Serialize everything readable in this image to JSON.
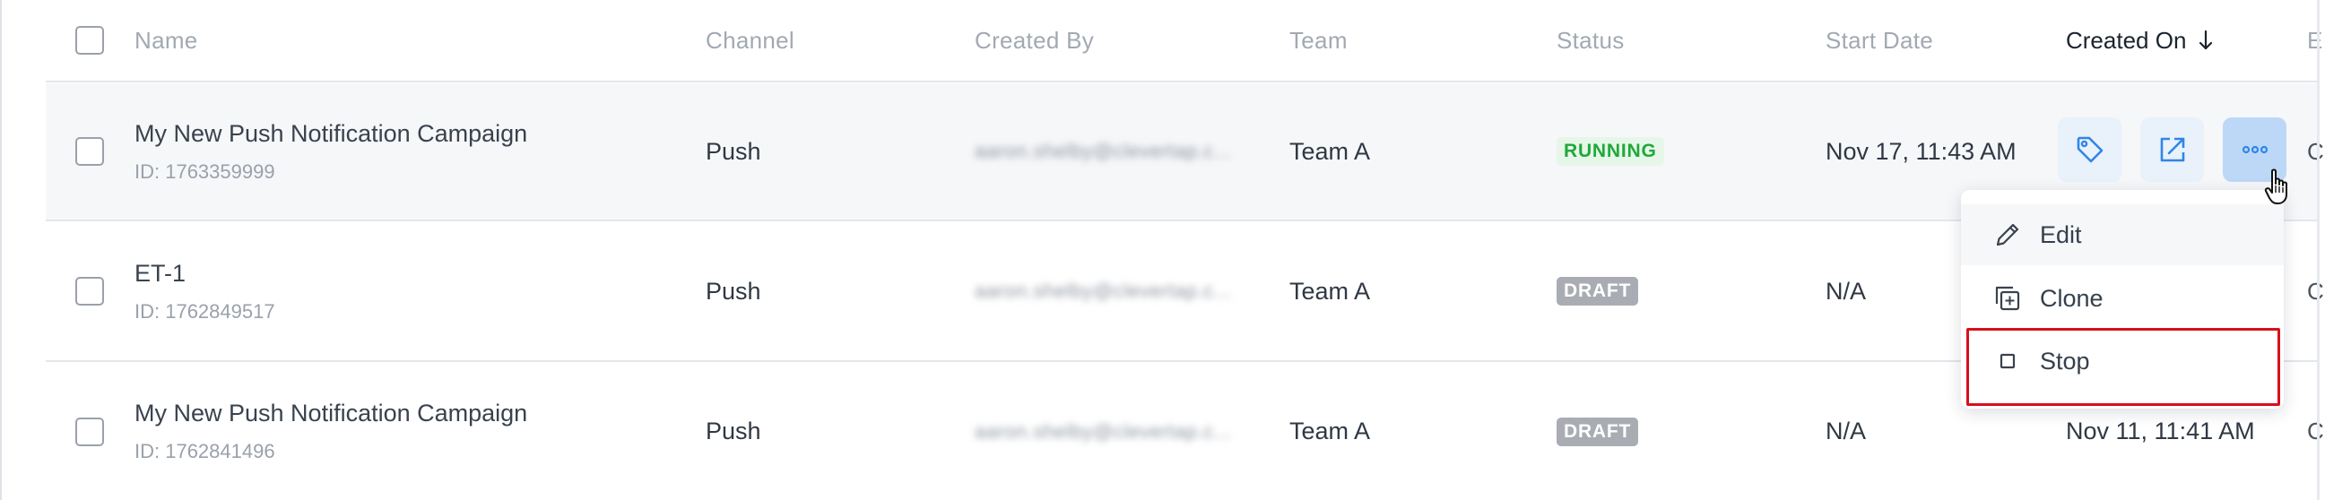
{
  "table": {
    "headers": {
      "name": "Name",
      "channel": "Channel",
      "created_by": "Created By",
      "team": "Team",
      "status": "Status",
      "start_date": "Start Date",
      "created_on": "Created On",
      "extra": "E"
    },
    "sort": {
      "column": "Created On",
      "direction": "descending",
      "icon": "arrow-down-icon"
    },
    "rows": [
      {
        "name": "My New Push Notification Campaign",
        "id": "ID: 1763359999",
        "channel": "Push",
        "created_by": "aaron.shelby@clevertap.c...",
        "team": "Team A",
        "status": "RUNNING",
        "start_date": "Nov 17, 11:43 AM",
        "created_on": "",
        "extra": "C"
      },
      {
        "name": "ET-1",
        "id": "ID: 1762849517",
        "channel": "Push",
        "created_by": "aaron.shelby@clevertap.c...",
        "team": "Team A",
        "status": "DRAFT",
        "start_date": "N/A",
        "created_on": "",
        "extra": "C"
      },
      {
        "name": "My New Push Notification Campaign",
        "id": "ID: 1762841496",
        "channel": "Push",
        "created_by": "aaron.shelby@clevertap.c...",
        "team": "Team A",
        "status": "DRAFT",
        "start_date": "N/A",
        "created_on": "Nov 11, 11:41 AM",
        "extra": "C"
      }
    ]
  },
  "row_actions": [
    {
      "icon": "tag-icon"
    },
    {
      "icon": "external-link-icon"
    },
    {
      "icon": "more-horizontal-icon"
    }
  ],
  "context_menu": {
    "items": [
      {
        "label": "Edit",
        "icon": "pencil-icon"
      },
      {
        "label": "Clone",
        "icon": "clone-icon"
      },
      {
        "label": "Stop",
        "icon": "stop-icon"
      }
    ]
  },
  "colors": {
    "accent": "#2f86e8",
    "running": "#20a83a",
    "draft": "#a9adb3",
    "highlight": "#d8101c"
  }
}
